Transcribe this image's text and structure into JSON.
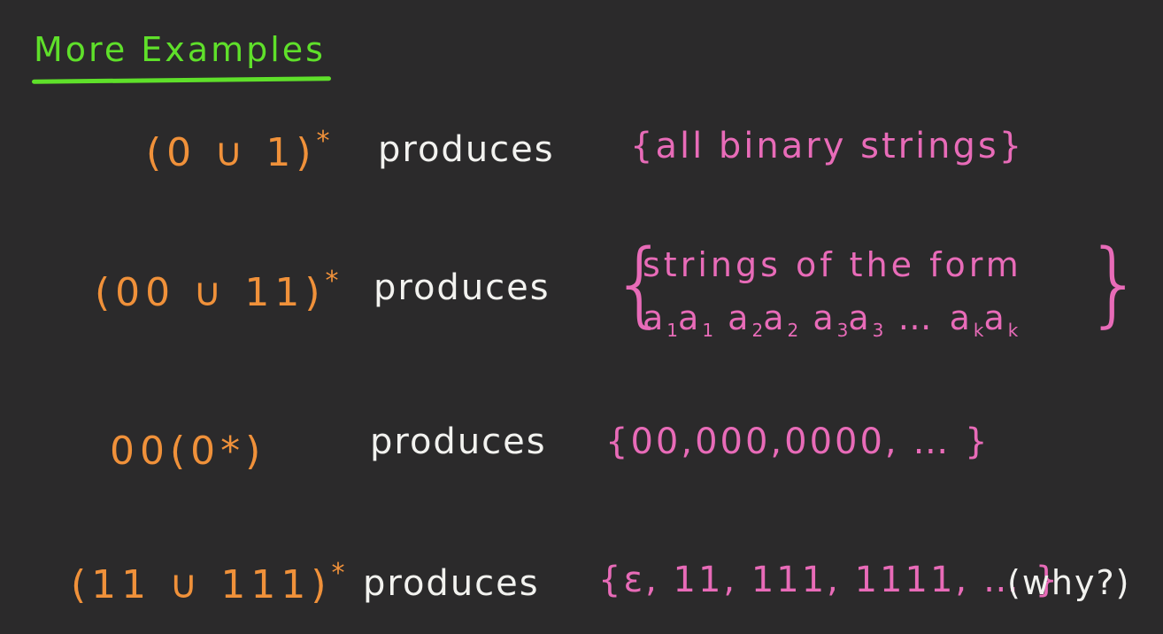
{
  "title": "More Examples",
  "colors": {
    "background": "#2b2a2b",
    "title": "#5fe02a",
    "expression": "#f0913a",
    "verb": "#f2f2ef",
    "set": "#e86bb8"
  },
  "examples": [
    {
      "expression": "(0 ∪ 1)",
      "star": "*",
      "verb": "produces",
      "result": "{all binary strings}"
    },
    {
      "expression": "(00 ∪ 11)",
      "star": "*",
      "verb": "produces",
      "result_open": "{",
      "result_line1": "strings of the form",
      "result_line2_prefix": "a",
      "result_pairs": [
        {
          "base": "a",
          "sub": "1"
        },
        {
          "base": "a",
          "sub": "1"
        },
        {
          "base": "a",
          "sub": "2"
        },
        {
          "base": "a",
          "sub": "2"
        },
        {
          "base": "a",
          "sub": "3"
        },
        {
          "base": "a",
          "sub": "3"
        }
      ],
      "result_ellipsis": "…",
      "result_last": [
        {
          "base": "a",
          "sub": "k"
        },
        {
          "base": "a",
          "sub": "k"
        }
      ],
      "result_close": "}"
    },
    {
      "expression": "00(0*)",
      "verb": "produces",
      "result": "{00,000,0000, … }"
    },
    {
      "expression": "(11 ∪ 111)",
      "star": "*",
      "verb": "produces",
      "result": "{ε, 11, 111, 1111, … }",
      "note": "(why?)"
    }
  ]
}
